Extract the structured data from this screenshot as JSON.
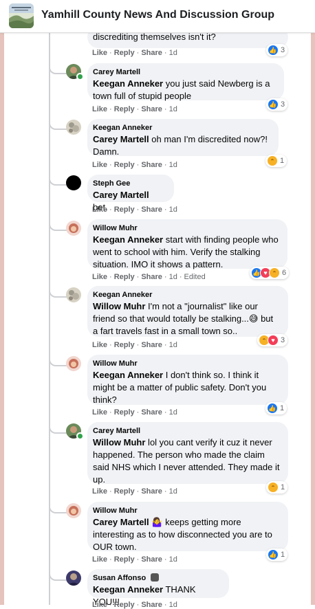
{
  "header": {
    "title": "Yamhill County News And Discussion Group"
  },
  "comments": [
    {
      "text": "discrediting themselves isn't it?",
      "actions": {
        "like": "Like",
        "reply": "Reply",
        "share": "Share",
        "time": "1d"
      },
      "reaction_count": "3"
    },
    {
      "author": "Carey Martell",
      "tag": "Keegan Anneker",
      "text": " you just said Newberg is a town full of stupid people",
      "actions": {
        "like": "Like",
        "reply": "Reply",
        "share": "Share",
        "time": "1d"
      },
      "reaction_count": "3"
    },
    {
      "author": "Keegan Anneker",
      "tag": "Carey Martell",
      "text": " oh man I'm discredited now?! Damn.",
      "actions": {
        "like": "Like",
        "reply": "Reply",
        "share": "Share",
        "time": "1d"
      },
      "reaction_count": "1"
    },
    {
      "author": "Steph Gee",
      "tag": "Carey Martell",
      "text": " bet.",
      "actions": {
        "like": "Like",
        "reply": "Reply",
        "share": "Share",
        "time": "1d"
      }
    },
    {
      "author": "Willow Muhr",
      "tag": "Keegan Anneker",
      "text": " start with finding people who went to school with him. Verify the stalking situation. IMO it shows a pattern.",
      "actions": {
        "like": "Like",
        "reply": "Reply",
        "share": "Share",
        "time": "1d",
        "edited": "Edited"
      },
      "reaction_count": "6"
    },
    {
      "author": "Keegan Anneker",
      "tag": "Willow Muhr",
      "text": " I'm not a \"journalist\" like our friend so that would totally be stalking...😅 but a fart travels fast in a small town so..",
      "actions": {
        "like": "Like",
        "reply": "Reply",
        "share": "Share",
        "time": "1d"
      },
      "reaction_count": "3"
    },
    {
      "author": "Willow Muhr",
      "tag": "Keegan Anneker",
      "text": " I don't think so. I think it might be a matter of public safety. Don't you think?",
      "actions": {
        "like": "Like",
        "reply": "Reply",
        "share": "Share",
        "time": "1d"
      },
      "reaction_count": "1"
    },
    {
      "author": "Carey Martell",
      "tag": "Willow Muhr",
      "text": " lol you cant verify it cuz it never happened. The person who made the claim said NHS which I never attended. They made it up.",
      "actions": {
        "like": "Like",
        "reply": "Reply",
        "share": "Share",
        "time": "1d"
      },
      "reaction_count": "1"
    },
    {
      "author": "Willow Muhr",
      "tag": "Carey Martell",
      "text": " 🤷‍♀️ keeps getting more interesting as to how disconnected you are to OUR town.",
      "actions": {
        "like": "Like",
        "reply": "Reply",
        "share": "Share",
        "time": "1d"
      },
      "reaction_count": "1"
    },
    {
      "author": "Susan Affonso",
      "tag": "Keegan Anneker",
      "text": " THANK YOU!!!",
      "actions": {
        "like": "Like",
        "reply": "Reply",
        "share": "Share",
        "time": "1d"
      }
    }
  ],
  "colors": {
    "link": "#1877f2",
    "bubble": "#f0f2f5",
    "meta": "#65676b",
    "edge": "#e5c4bd"
  }
}
